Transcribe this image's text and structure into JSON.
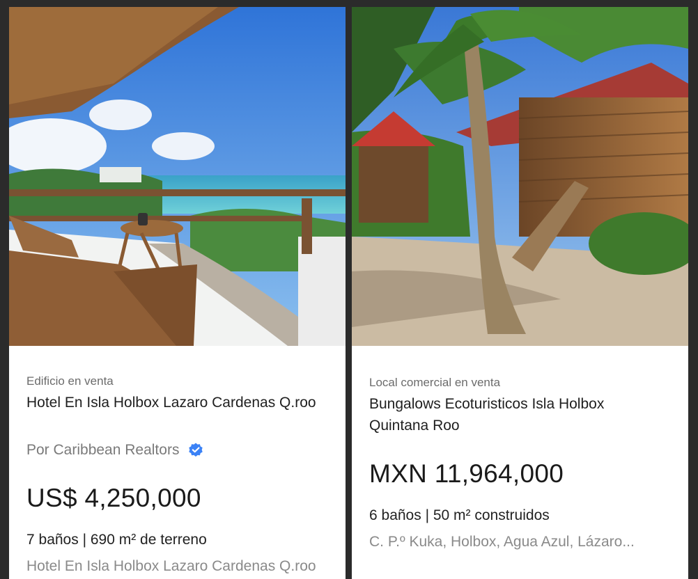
{
  "listings": [
    {
      "type": "Edificio en venta",
      "title": "Hotel En Isla Holbox Lazaro Cardenas Q.roo",
      "publisher": "Por Caribbean Realtors",
      "price": "US$ 4,250,000",
      "features": "7 baños | 690 m² de terreno",
      "address": "Hotel En Isla Holbox Lazaro Cardenas Q.roo",
      "image": "beach-terrace-photo"
    },
    {
      "type": "Local comercial en venta",
      "title": "Bungalows Ecoturisticos Isla Holbox Quintana Roo",
      "price": "MXN 11,964,000",
      "features": "6 baños | 50 m² construidos",
      "address": "C. P.º Kuka, Holbox, Agua Azul, Lázaro...",
      "image": "wooden-bungalow-photo"
    }
  ],
  "icons": {
    "verified": "verified-badge-icon"
  },
  "colors": {
    "verified": "#3b82f6",
    "background": "#2b2b2b"
  }
}
